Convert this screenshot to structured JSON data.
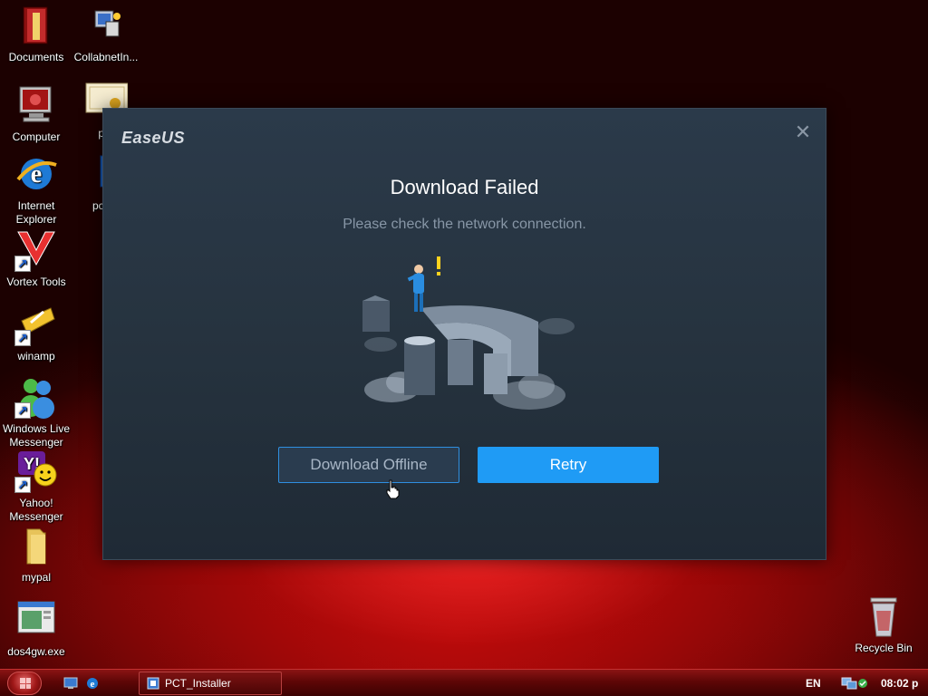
{
  "desktop": {
    "icons": [
      {
        "label": "Documents"
      },
      {
        "label": "CollabnetIn..."
      },
      {
        "label": "Computer"
      },
      {
        "label": "per"
      },
      {
        "label": "Internet Explorer"
      },
      {
        "label": "pct_fr"
      },
      {
        "label": "Vortex Tools"
      },
      {
        "label": "winamp"
      },
      {
        "label": "Windows Live Messenger"
      },
      {
        "label": "Yahoo! Messenger"
      },
      {
        "label": "mypal"
      },
      {
        "label": "dos4gw.exe"
      },
      {
        "label": "Recycle Bin"
      }
    ]
  },
  "dialog": {
    "brand": "EaseUS",
    "title": "Download Failed",
    "subtitle": "Please check the network connection.",
    "btn_offline": "Download Offline",
    "btn_retry": "Retry",
    "close_glyph": "✕"
  },
  "taskbar": {
    "task_label": "PCT_Installer",
    "lang": "EN",
    "clock": "08:02 p"
  },
  "colors": {
    "accent": "#1f9bf5",
    "dialog_bg": "#26333f"
  },
  "icons": [
    "folder-icon",
    "computer-icon",
    "internet-explorer-icon",
    "vortex-icon",
    "winamp-icon",
    "messenger-icon",
    "yahoo-icon",
    "recycle-bin-icon",
    "close-icon",
    "start-orb-icon"
  ]
}
